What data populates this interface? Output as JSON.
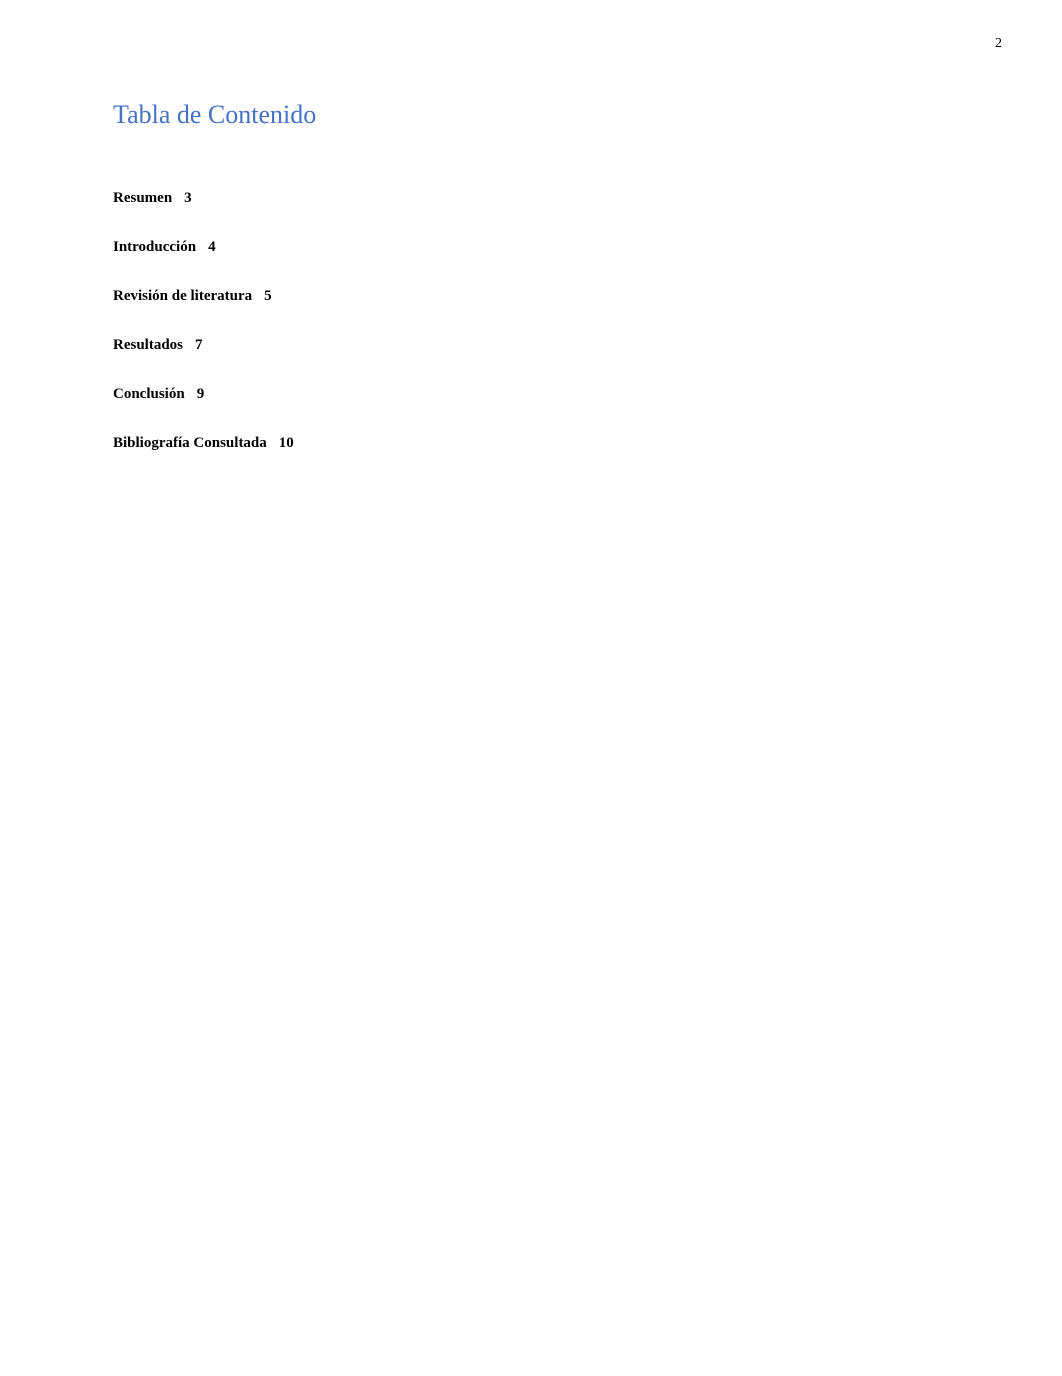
{
  "page": {
    "number": "2",
    "title": "Tabla de Contenido",
    "toc_items": [
      {
        "label": "Resumen",
        "page": "3"
      },
      {
        "label": "Introducción",
        "page": "4"
      },
      {
        "label": "Revisión de literatura",
        "page": "5"
      },
      {
        "label": "Resultados",
        "page": "7"
      },
      {
        "label": "Conclusión",
        "page": "9"
      },
      {
        "label": "Bibliografía Consultada",
        "page": "10"
      }
    ]
  }
}
